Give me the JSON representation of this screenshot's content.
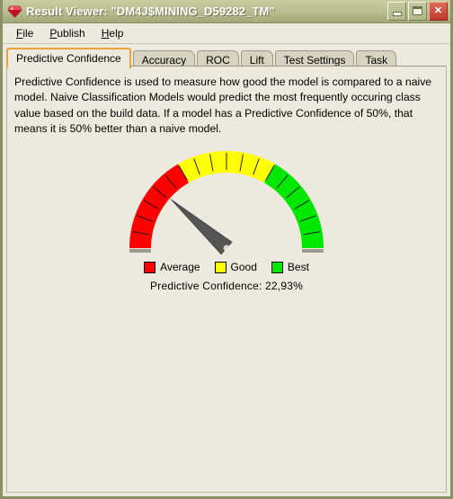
{
  "window": {
    "title": "Result Viewer: \"DM4J$MINING_D59282_TM\"",
    "icon": "gem-icon",
    "controls": {
      "minimize": "minimize-button",
      "maximize": "maximize-button",
      "close_label": "✕"
    }
  },
  "menu": {
    "items": [
      {
        "label": "File",
        "mnemonic": "F"
      },
      {
        "label": "Publish",
        "mnemonic": "P"
      },
      {
        "label": "Help",
        "mnemonic": "H"
      }
    ]
  },
  "tabs": {
    "active_index": 0,
    "items": [
      {
        "label": "Predictive Confidence"
      },
      {
        "label": "Accuracy"
      },
      {
        "label": "ROC"
      },
      {
        "label": "Lift"
      },
      {
        "label": "Test Settings"
      },
      {
        "label": "Task"
      }
    ]
  },
  "main": {
    "description": "Predictive Confidence is used to measure how good the model is compared to a naive model. Naive Classification Models would predict the most frequently occuring class value based on the build data. If a model has a Predictive Confidence of 50%, that means it is 50% better than a naive model.",
    "confidence_text": "Predictive Confidence: 22,93%"
  },
  "chart_data": {
    "type": "gauge",
    "title": "Predictive Confidence",
    "value": 22.93,
    "value_label": "22,93%",
    "min": 0,
    "max": 100,
    "unit": "%",
    "start_angle_deg": 180,
    "end_angle_deg": 0,
    "tick_count": 18,
    "needle_color": "#555555",
    "bands": [
      {
        "name": "Average",
        "from": 0,
        "to": 33.33,
        "color": "#FF0000"
      },
      {
        "name": "Good",
        "from": 33.33,
        "to": 66.66,
        "color": "#FFFF00"
      },
      {
        "name": "Best",
        "from": 66.66,
        "to": 100,
        "color": "#00E800"
      }
    ],
    "legend": [
      {
        "label": "Average",
        "color": "#FF0000"
      },
      {
        "label": "Good",
        "color": "#FFFF00"
      },
      {
        "label": "Best",
        "color": "#00E800"
      }
    ],
    "legend_position": "bottom"
  },
  "colors": {
    "titlebar": "#bcc094",
    "window_border": "#8a9166",
    "content_bg": "#eceade",
    "tab_inactive": "#d6d3c0",
    "tab_active_border": "#e8a33d",
    "red": "#FF0000",
    "yellow": "#FFFF00",
    "green": "#00E800"
  }
}
